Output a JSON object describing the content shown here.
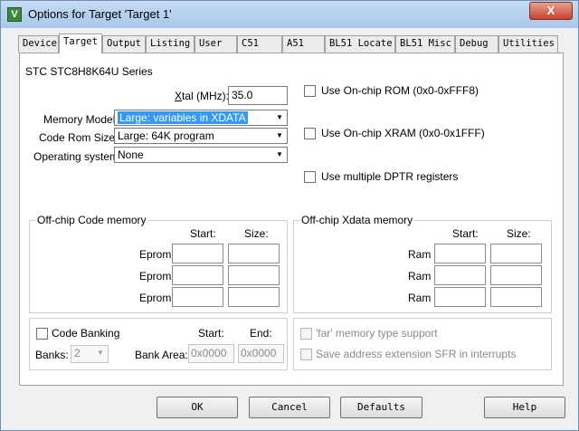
{
  "window": {
    "app_icon": "V",
    "title": "Options for Target 'Target 1'",
    "close_label": "X"
  },
  "tabs": [
    "Device",
    "Target",
    "Output",
    "Listing",
    "User",
    "C51",
    "A51",
    "BL51 Locate",
    "BL51 Misc",
    "Debug",
    "Utilities"
  ],
  "target": {
    "device_series": "STC STC8H8K64U Series",
    "xtal": {
      "label": "tal (MHz):",
      "label_underlined": "X",
      "value": "35.0"
    },
    "memory_model": {
      "label": "Memory Model:",
      "value": "Large: variables in XDATA"
    },
    "code_rom_size": {
      "label": "Code Rom Size:",
      "value": "Large: 64K program"
    },
    "operating_system": {
      "label": "Operating system:",
      "value": "None"
    },
    "checks": {
      "onchip_rom": "Use On-chip ROM (0x0-0xFFF8)",
      "onchip_xram": "Use On-chip XRAM (0x0-0x1FFF)",
      "multi_dptr": "Use multiple DPTR registers"
    },
    "code_memory": {
      "title": "Off-chip Code memory",
      "start_header": "Start:",
      "size_header": "Size:",
      "rows": [
        "Eprom",
        "Eprom",
        "Eprom"
      ]
    },
    "xdata_memory": {
      "title": "Off-chip Xdata memory",
      "start_header": "Start:",
      "size_header": "Size:",
      "rows": [
        "Ram",
        "Ram",
        "Ram"
      ]
    },
    "banking": {
      "label": "Code Banking",
      "start_header": "Start:",
      "end_header": "End:",
      "banks_label": "Banks:",
      "banks_value": "2",
      "bank_area_label": "Bank Area:",
      "start_value": "0x0000",
      "end_value": "0x0000"
    },
    "far_support": "'far' memory type support",
    "save_sfr": "Save address extension SFR in interrupts"
  },
  "buttons": {
    "ok": "OK",
    "cancel": "Cancel",
    "defaults": "Defaults",
    "help": "Help"
  }
}
